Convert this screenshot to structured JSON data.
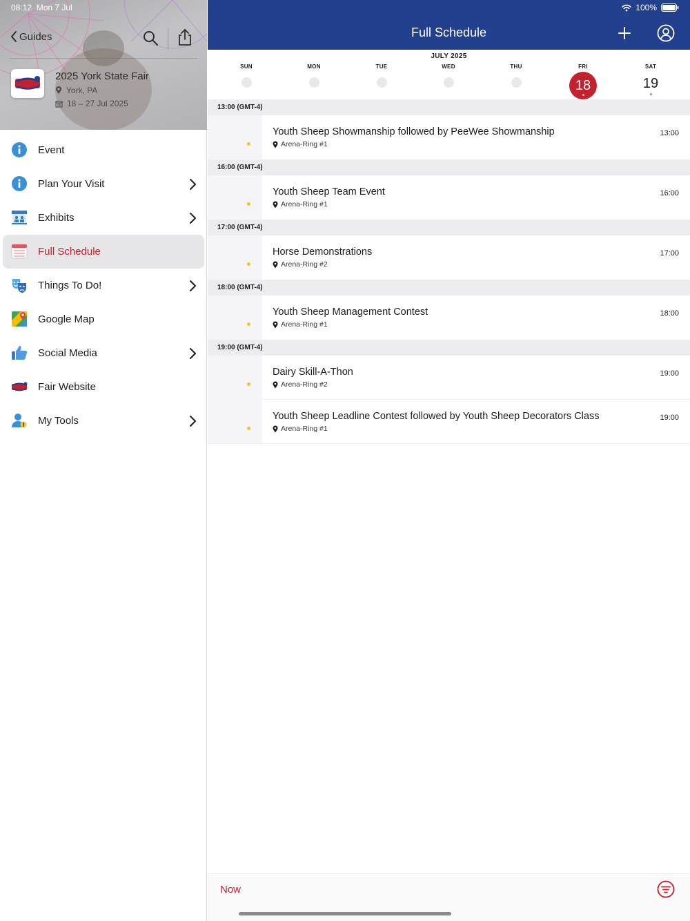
{
  "status_bar": {
    "time": "08:12",
    "date": "Mon 7 Jul",
    "battery": "100%"
  },
  "sidebar": {
    "back_label": "Guides",
    "event_title": "2025 York State Fair",
    "location": "York, PA",
    "dates": "18 – 27 Jul 2025",
    "items": [
      {
        "label": "Event",
        "icon": "info-icon",
        "chevron": false
      },
      {
        "label": "Plan Your Visit",
        "icon": "info-icon",
        "chevron": true
      },
      {
        "label": "Exhibits",
        "icon": "exhibits-booth-icon",
        "chevron": true
      },
      {
        "label": "Full Schedule",
        "icon": "calendar-icon",
        "chevron": false,
        "active": true
      },
      {
        "label": "Things To Do!",
        "icon": "theater-masks-icon",
        "chevron": true
      },
      {
        "label": "Google Map",
        "icon": "google-maps-icon",
        "chevron": false
      },
      {
        "label": "Social Media",
        "icon": "thumbs-up-icon",
        "chevron": true
      },
      {
        "label": "Fair Website",
        "icon": "york-fair-logo-icon",
        "chevron": false
      },
      {
        "label": "My Tools",
        "icon": "user-tools-icon",
        "chevron": true
      }
    ]
  },
  "header": {
    "title": "Full Schedule"
  },
  "calendar": {
    "month": "JULY 2025",
    "days": [
      {
        "name": "SUN",
        "num": ""
      },
      {
        "name": "MON",
        "num": ""
      },
      {
        "name": "TUE",
        "num": ""
      },
      {
        "name": "WED",
        "num": ""
      },
      {
        "name": "THU",
        "num": ""
      },
      {
        "name": "FRI",
        "num": "18",
        "selected": true
      },
      {
        "name": "SAT",
        "num": "19"
      }
    ]
  },
  "schedule": [
    {
      "header": "13:00 (GMT-4)",
      "events": [
        {
          "time": "13:00",
          "title": "Youth Sheep Showmanship followed by PeeWee Showmanship",
          "location": "Arena-Ring #1"
        }
      ]
    },
    {
      "header": "16:00 (GMT-4)",
      "events": [
        {
          "time": "16:00",
          "title": "Youth Sheep Team Event",
          "location": "Arena-Ring #1"
        }
      ]
    },
    {
      "header": "17:00 (GMT-4)",
      "events": [
        {
          "time": "17:00",
          "title": "Horse Demonstrations",
          "location": "Arena-Ring #2"
        }
      ]
    },
    {
      "header": "18:00 (GMT-4)",
      "events": [
        {
          "time": "18:00",
          "title": "Youth Sheep Management Contest",
          "location": "Arena-Ring #1"
        }
      ]
    },
    {
      "header": "19:00 (GMT-4)",
      "events": [
        {
          "time": "19:00",
          "title": "Dairy Skill-A-Thon",
          "location": "Arena-Ring #2"
        },
        {
          "time": "19:00",
          "title": "Youth Sheep Leadline Contest followed by Youth Sheep Decorators Class",
          "location": "Arena-Ring #1"
        }
      ]
    }
  ],
  "footer": {
    "now_label": "Now"
  },
  "colors": {
    "navbar": "#22408e",
    "accent": "#c4212f",
    "event_dot": "#f1c232"
  }
}
